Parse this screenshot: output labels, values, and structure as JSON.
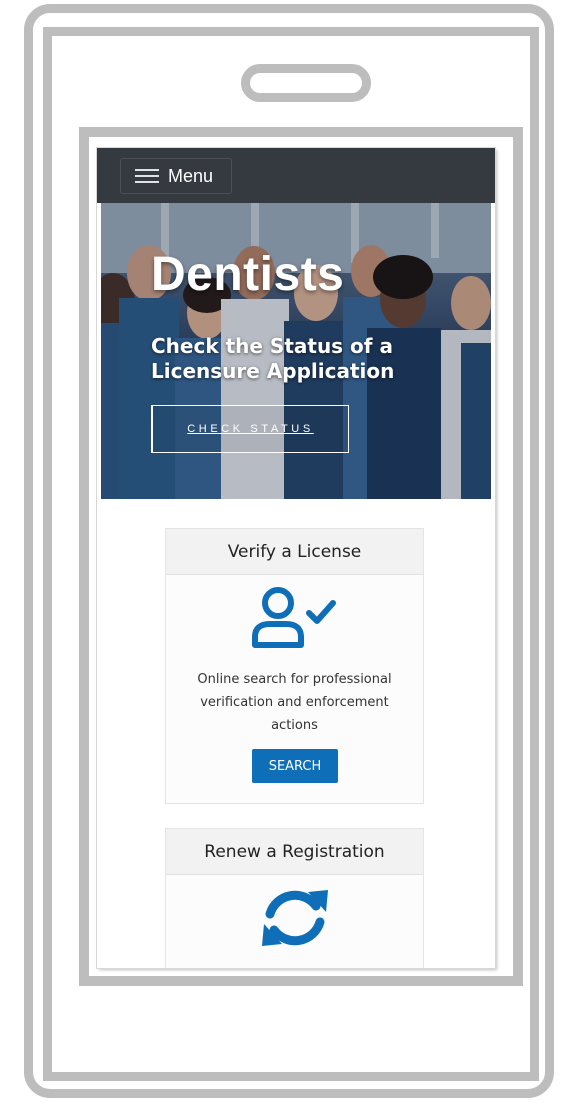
{
  "navbar": {
    "menu_label": "Menu"
  },
  "hero": {
    "title": "Dentists",
    "subtitle": "Check the Status of a Licensure Application",
    "button_label": "CHECK STATUS"
  },
  "cards": {
    "verify": {
      "title": "Verify a License",
      "icon": "user-check-icon",
      "description": "Online search for professional verification and enforcement actions",
      "button_label": "SEARCH"
    },
    "renew": {
      "title": "Renew a Registration",
      "icon": "refresh-icon"
    }
  },
  "colors": {
    "navbar": "#343a40",
    "accent_blue": "#0e6eb8",
    "card_header": "#f2f2f2",
    "device_frame": "#bdbdbd"
  }
}
